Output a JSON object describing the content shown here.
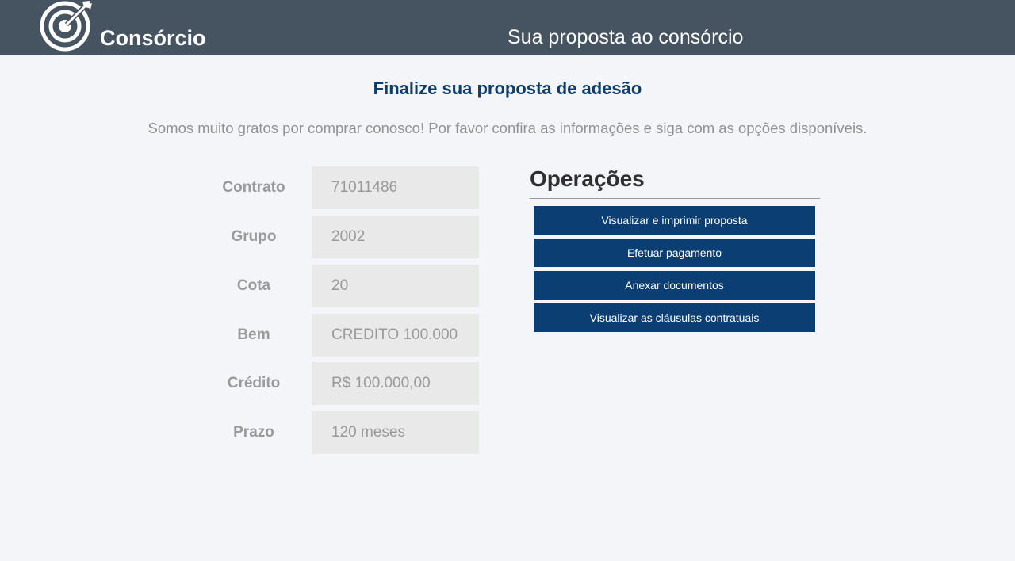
{
  "header": {
    "brand": "Consórcio",
    "title": "Sua proposta ao consórcio"
  },
  "main": {
    "title": "Finalize sua proposta de adesão",
    "subtitle": "Somos muito gratos por comprar conosco! Por favor confira as informações e siga com as opções disponíveis."
  },
  "info": [
    {
      "label": "Contrato",
      "value": "71011486"
    },
    {
      "label": "Grupo",
      "value": "2002"
    },
    {
      "label": "Cota",
      "value": "20"
    },
    {
      "label": "Bem",
      "value": "CREDITO 100.000"
    },
    {
      "label": "Crédito",
      "value": "R$ 100.000,00"
    },
    {
      "label": "Prazo",
      "value": "120 meses"
    }
  ],
  "operations": {
    "title": "Operações",
    "buttons": [
      "Visualizar e imprimir proposta",
      "Efetuar pagamento",
      "Anexar documentos",
      "Visualizar as cláusulas contratuais"
    ]
  },
  "colors": {
    "header_bg": "#465361",
    "page_bg": "#f4f5f9",
    "accent": "#0b3e72",
    "title": "#0d3d6b"
  },
  "icons": {
    "logo": "target-arrow-icon"
  }
}
